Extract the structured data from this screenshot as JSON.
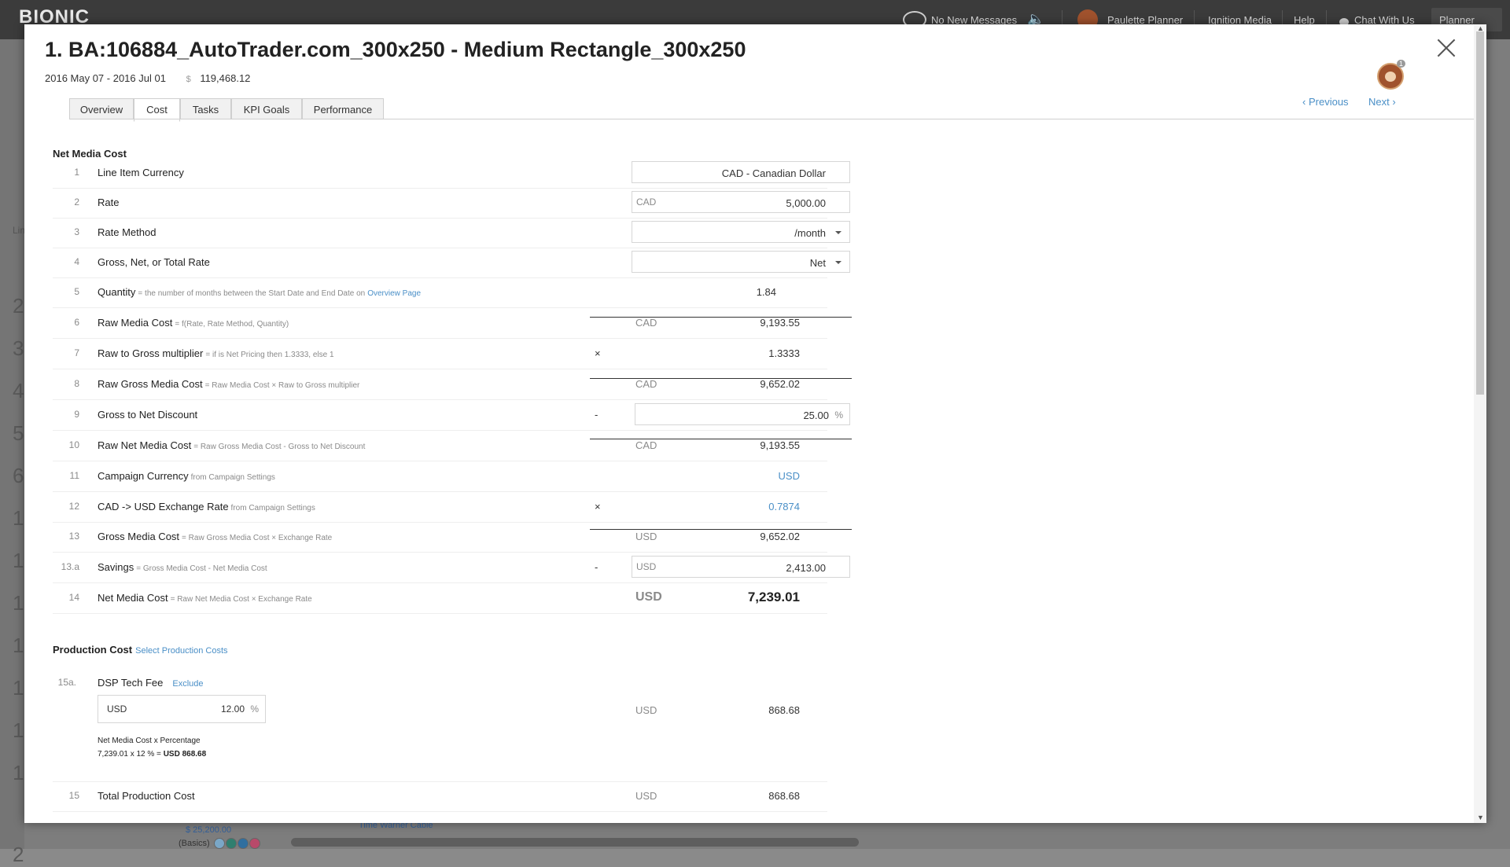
{
  "app": {
    "logo": "BIONIC",
    "messages": "No New Messages",
    "user": "Paulette Planner",
    "company": "Ignition Media",
    "help": "Help",
    "chat": "Chat With Us",
    "role": "Planner",
    "bg_bottom_value": "$ 25,200.00",
    "bg_bottom_label": "(Basics)",
    "bg_bottom_link": "Time Warner Cable",
    "bg_header_label": "Lin",
    "bg_row_numbers": [
      "2",
      "3",
      "4",
      "5",
      "6",
      "1",
      "1",
      "1",
      "1",
      "1",
      "1",
      "1",
      "2"
    ]
  },
  "modal": {
    "title": "1. BA:106884_AutoTrader.com_300x250 - Medium Rectangle_300x250",
    "dates": "2016 May 07 - 2016 Jul 01",
    "currency_symbol": "$",
    "budget": "119,468.12",
    "avatar_badge": "1",
    "previous": "Previous",
    "next": "Next",
    "tabs": [
      "Overview",
      "Cost",
      "Tasks",
      "KPI Goals",
      "Performance"
    ]
  },
  "net_media": {
    "title": "Net Media Cost",
    "rows": [
      {
        "num": "1",
        "label": "Line Item Currency",
        "value": "CAD - Canadian Dollar"
      },
      {
        "num": "2",
        "label": "Rate",
        "currency": "CAD",
        "value": "5,000.00"
      },
      {
        "num": "3",
        "label": "Rate Method",
        "value": "/month"
      },
      {
        "num": "4",
        "label": "Gross, Net, or Total Rate",
        "value": "Net"
      },
      {
        "num": "5",
        "label": "Quantity",
        "formula": "= the number of months between the Start Date and End Date on",
        "link": "Overview Page",
        "value": "1.84"
      },
      {
        "num": "6",
        "label": "Raw Media Cost",
        "formula": "= f(Rate, Rate Method, Quantity)",
        "currency": "CAD",
        "value": "9,193.55"
      },
      {
        "num": "7",
        "label": "Raw to Gross multiplier",
        "formula": "= if is Net Pricing then 1.3333, else 1",
        "op": "×",
        "value": "1.3333"
      },
      {
        "num": "8",
        "label": "Raw Gross Media Cost",
        "formula": "= Raw Media Cost × Raw to Gross multiplier",
        "currency": "CAD",
        "value": "9,652.02"
      },
      {
        "num": "9",
        "label": "Gross to Net Discount",
        "op": "-",
        "value": "25.00",
        "unit": "%"
      },
      {
        "num": "10",
        "label": "Raw Net Media Cost",
        "formula": "= Raw Gross Media Cost - Gross to Net Discount",
        "currency": "CAD",
        "value": "9,193.55"
      },
      {
        "num": "11",
        "label": "Campaign Currency",
        "formula": "from Campaign Settings",
        "value": "USD"
      },
      {
        "num": "12",
        "label": "CAD -> USD Exchange Rate",
        "formula": "from Campaign Settings",
        "op": "×",
        "value": "0.7874"
      },
      {
        "num": "13",
        "label": "Gross Media Cost",
        "formula": "= Raw Gross Media Cost × Exchange Rate",
        "currency": "USD",
        "value": "9,652.02"
      },
      {
        "num": "13.a",
        "label": "Savings",
        "formula": "= Gross Media Cost - Net Media Cost",
        "op": "-",
        "currency": "USD",
        "value": "2,413.00"
      },
      {
        "num": "14",
        "label": "Net Media Cost",
        "formula": "= Raw Net Media Cost × Exchange Rate",
        "currency": "USD",
        "value": "7,239.01"
      }
    ]
  },
  "production": {
    "title": "Production Cost",
    "select_link": "Select Production Costs",
    "dsp": {
      "num": "15a.",
      "label": "DSP Tech Fee",
      "exclude": "Exclude",
      "input_currency": "USD",
      "input_value": "12.00",
      "input_unit": "%",
      "note1": "Net Media Cost x Percentage",
      "note2": "7,239.01 x 12 % =",
      "note2_result": "USD 868.68",
      "currency": "USD",
      "value": "868.68"
    },
    "total": {
      "num": "15",
      "label": "Total Production Cost",
      "currency": "USD",
      "value": "868.68"
    }
  }
}
